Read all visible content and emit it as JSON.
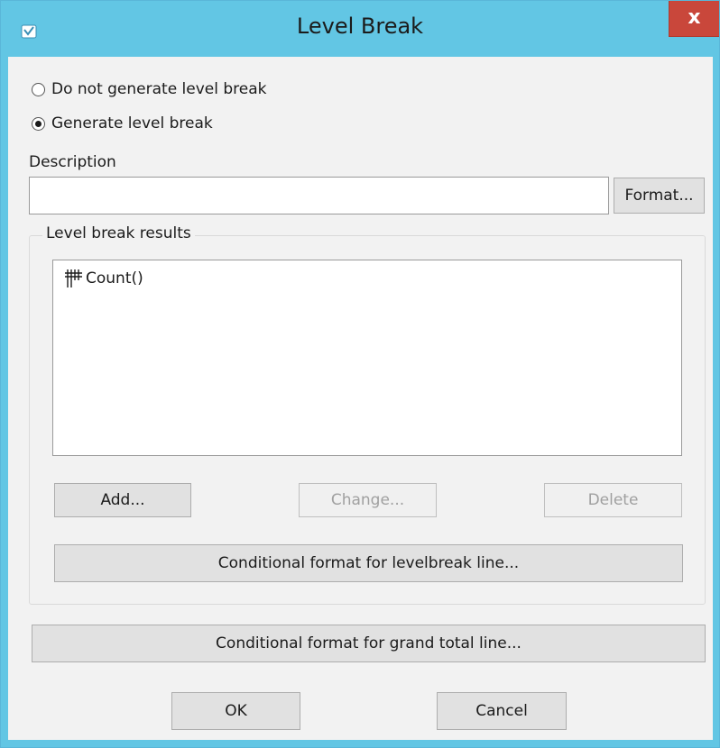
{
  "window": {
    "title": "Level Break",
    "close_label": "x"
  },
  "options": {
    "no_break": "Do not generate level break",
    "generate_break": "Generate level break",
    "selected": "generate_break"
  },
  "description": {
    "label": "Description",
    "value": "",
    "format_button": "Format..."
  },
  "results_group": {
    "label": "Level break results",
    "items": [
      "Count()"
    ],
    "add_button": "Add...",
    "change_button": "Change...",
    "delete_button": "Delete",
    "levelbreak_format_button": "Conditional format for levelbreak line..."
  },
  "grand_total_button": "Conditional format for grand total line...",
  "footer": {
    "ok_button": "OK",
    "cancel_button": "Cancel"
  },
  "colors": {
    "title_bar": "#62c6e4",
    "close_button": "#c9473b",
    "dialog_bg": "#f2f2f2"
  },
  "icons": {
    "app": "app-shield-icon",
    "list_item": "tally-icon"
  }
}
